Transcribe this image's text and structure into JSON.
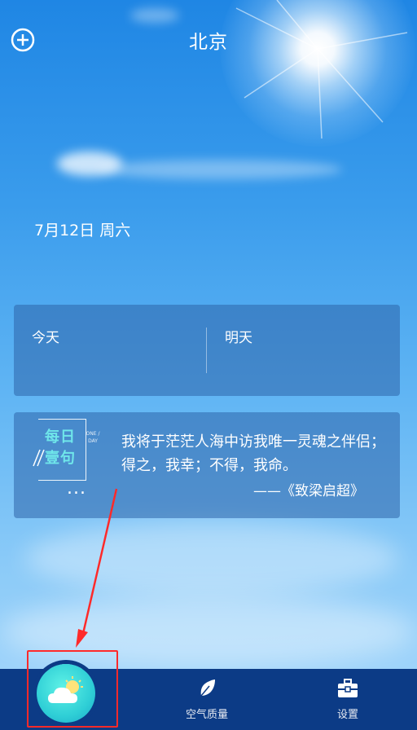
{
  "header": {
    "city": "北京",
    "add_icon": "plus-circle-icon"
  },
  "date_line": "7月12日 周六",
  "forecast": {
    "today_label": "今天",
    "tomorrow_label": "明天"
  },
  "daily_quote": {
    "badge_line1": "每日",
    "badge_line2": "壹句",
    "badge_sub": "ONE / DAY",
    "more": "...",
    "text": "我将于茫茫人海中访我唯一灵魂之伴侣；得之，我幸；不得，我命。",
    "source": "——《致梁启超》"
  },
  "bottom_nav": {
    "items": [
      {
        "label": "",
        "icon": "cloud-sun-icon"
      },
      {
        "label": "空气质量",
        "icon": "leaf-icon"
      },
      {
        "label": "设置",
        "icon": "toolbox-icon"
      }
    ]
  },
  "colors": {
    "nav_background": "#0c3b86",
    "accent_teal": "#6fe6ea",
    "annotation_red": "#ff2a2a"
  }
}
